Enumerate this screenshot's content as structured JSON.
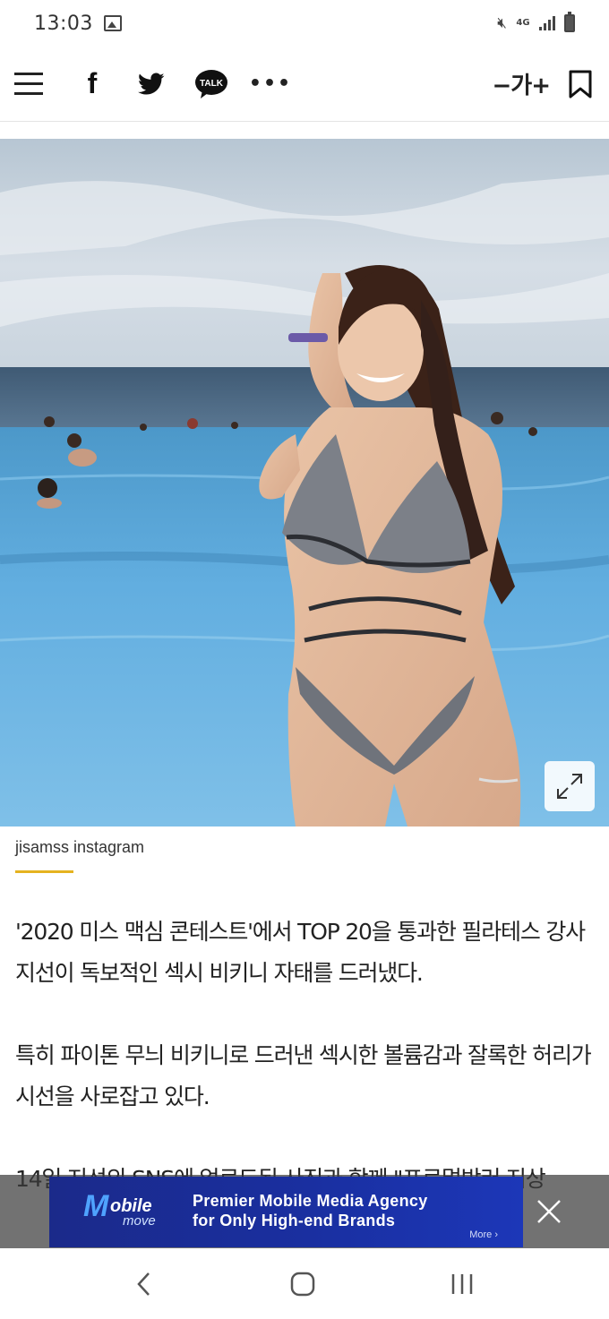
{
  "status_bar": {
    "time": "13:03",
    "network": "4G",
    "icons": [
      "image-icon",
      "mute-icon",
      "signal-icon",
      "battery-icon"
    ]
  },
  "toolbar": {
    "facebook": "f",
    "kakao_talk": "TALK",
    "more": "•••",
    "font_size": "−가+",
    "icons": [
      "menu-icon",
      "facebook-icon",
      "twitter-icon",
      "kakaotalk-icon",
      "more-icon",
      "bookmark-icon"
    ]
  },
  "photo": {
    "caption": "jisamss instagram",
    "expand_icon": "expand-icon"
  },
  "article": {
    "paragraphs": [
      "'2020 미스 맥심 콘테스트'에서 TOP 20을 통과한 필라테스 강사 지선이 독보적인 섹시 비키니 자태를 드러냈다.",
      "특히 파이톤 무늬 비키니로 드러낸 섹시한 볼륨감과 잘록한 허리가 시선을 사로잡고 있다.",
      "14일 지선의 SNS에 업로드된 사진과 함께 \"프로멀방러 지상"
    ]
  },
  "ad": {
    "logo_m": "M",
    "logo_obile": "obile",
    "logo_move": "move",
    "line1": "Premier Mobile Media Agency",
    "line2": "for Only High-end Brands",
    "more": "More ›",
    "colors": {
      "bg": "#1b2a8a",
      "logo": "#4fa3ff"
    }
  },
  "colors": {
    "accent_underline": "#e5b320",
    "text": "#222222"
  }
}
